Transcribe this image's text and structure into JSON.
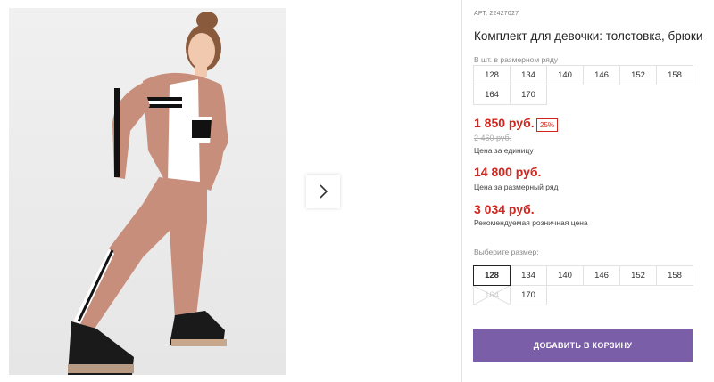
{
  "product": {
    "sku": "АРТ. 22427027",
    "title": "Комплект для девочки: толстовка, брюки",
    "row_label": "В шт. в размерном ряду",
    "row_sizes": [
      "128",
      "134",
      "140",
      "146",
      "152",
      "158",
      "164",
      "170"
    ]
  },
  "pricing": {
    "unit_price": "1 850 руб.",
    "discount": "25%",
    "old_price": "2 460 руб.",
    "unit_note": "Цена за единицу",
    "row_price": "14 800 руб.",
    "row_note": "Цена за размерный ряд",
    "rrp_price": "3 034 руб.",
    "rrp_note": "Рекомендуемая розничная цена",
    "colors": {
      "price": "#d0261d",
      "button": "#7b5ea8"
    }
  },
  "size_select": {
    "label": "Выберите размер:",
    "options": [
      {
        "value": "128",
        "state": "selected"
      },
      {
        "value": "134",
        "state": "available"
      },
      {
        "value": "140",
        "state": "available"
      },
      {
        "value": "146",
        "state": "available"
      },
      {
        "value": "152",
        "state": "available"
      },
      {
        "value": "158",
        "state": "available"
      },
      {
        "value": "164",
        "state": "disabled"
      },
      {
        "value": "170",
        "state": "available"
      }
    ]
  },
  "cart": {
    "add_label": "ДОБАВИТЬ В КОРЗИНУ"
  },
  "gallery": {
    "next_icon": "chevron-right-icon",
    "image": "product-photo"
  }
}
